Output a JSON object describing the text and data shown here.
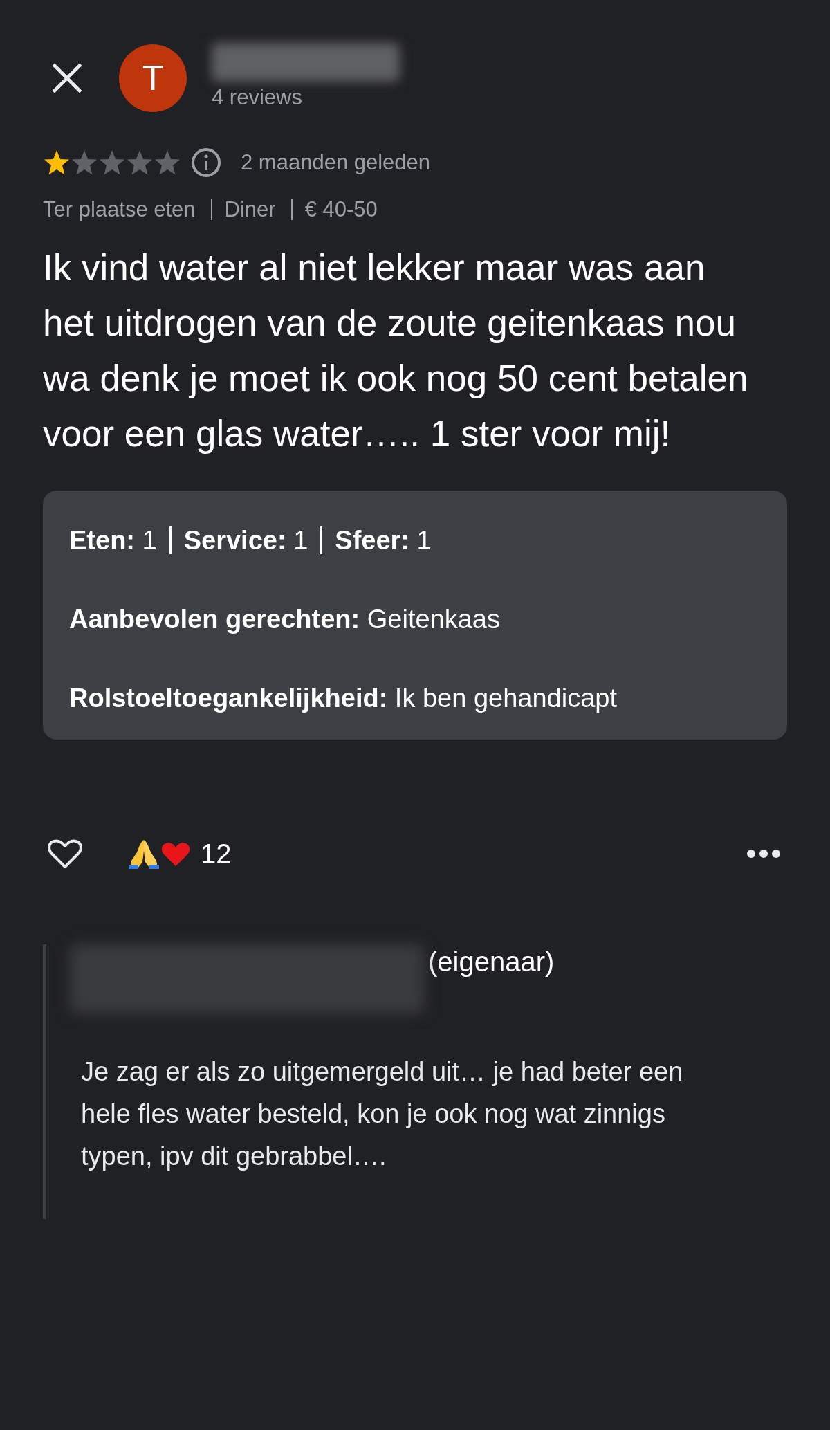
{
  "reviewer": {
    "avatar_letter": "T",
    "reviews": "4 reviews"
  },
  "rating": {
    "stars": 1,
    "time": "2 maanden geleden"
  },
  "meta": [
    "Ter plaatse eten",
    "Diner",
    "€ 40-50"
  ],
  "review_text": "Ik vind water al niet lekker maar was aan het uitdrogen van de zoute geitenkaas nou wa denk je moet ik ook nog 50 cent betalen voor een glas water….. 1 ster voor mij!",
  "details": {
    "scores": [
      {
        "label": "Eten:",
        "value": "1"
      },
      {
        "label": "Service:",
        "value": "1"
      },
      {
        "label": "Sfeer:",
        "value": "1"
      }
    ],
    "lines": [
      {
        "label": "Aanbevolen gerechten:",
        "value": "Geitenkaas"
      },
      {
        "label": "Rolstoeltoegankelijkheid:",
        "value": "Ik ben gehandicapt"
      }
    ]
  },
  "reactions": {
    "liked": false,
    "count": "12"
  },
  "owner_reply": {
    "role": "(eigenaar)",
    "text": "Je zag er als zo uitgemergeld uit… je had beter een hele fles water besteld, kon je ook nog wat zinnigs typen, ipv dit gebrabbel…."
  }
}
